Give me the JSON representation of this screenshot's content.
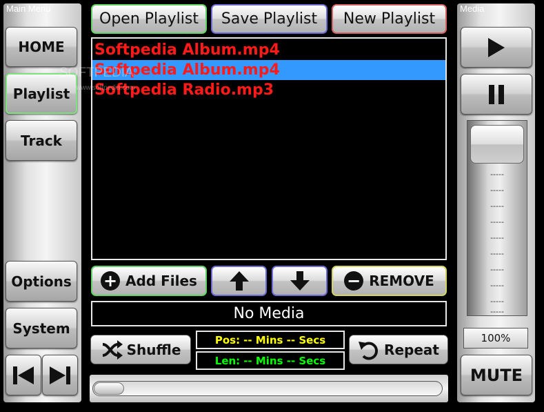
{
  "main_menu": {
    "title": "Main Menu",
    "home": "HOME",
    "playlist": "Playlist",
    "track": "Track",
    "options": "Options",
    "system": "System"
  },
  "media_panel": {
    "title": "Media",
    "volume_percent": "100%",
    "volume_level": 1.0,
    "ticks": [
      "-----",
      "-----",
      "-----",
      "-----",
      "-----",
      "-----",
      "-----",
      "-----",
      "-----",
      "-----",
      "-----"
    ],
    "mute": "MUTE"
  },
  "toolbar": {
    "open": "Open Playlist",
    "save": "Save Playlist",
    "new": "New Playlist"
  },
  "playlist": {
    "items": [
      "Softpedia Album.mp4",
      "Softpedia Album.mp4",
      "Softpedia Radio.mp3"
    ],
    "selected_index": 1
  },
  "watermark": {
    "text": "SOFTPEDIA",
    "sub": "www.softpedia.com"
  },
  "controls": {
    "add_files": "Add Files",
    "remove": "REMOVE",
    "shuffle": "Shuffle",
    "repeat": "Repeat"
  },
  "status": {
    "now_playing": "No Media"
  },
  "info": {
    "pos_label": "Pos:",
    "pos_value": "-- Mins -- Secs",
    "len_label": "Len:",
    "len_value": "-- Mins -- Secs",
    "pos_color": "#ffff00",
    "len_color": "#00ff00"
  },
  "seek": {
    "position": 0.0
  },
  "colors": {
    "playlist_text": "#ff1a1a",
    "selection": "#3399ff",
    "active_border": "#7ee27e"
  },
  "icons": {
    "play": "play-icon",
    "pause": "pause-icon",
    "prev": "skip-previous-icon",
    "next": "skip-next-icon",
    "add": "plus-circle-icon",
    "remove": "minus-circle-icon",
    "up": "arrow-up-icon",
    "down": "arrow-down-icon",
    "shuffle": "shuffle-icon",
    "repeat": "repeat-icon"
  }
}
